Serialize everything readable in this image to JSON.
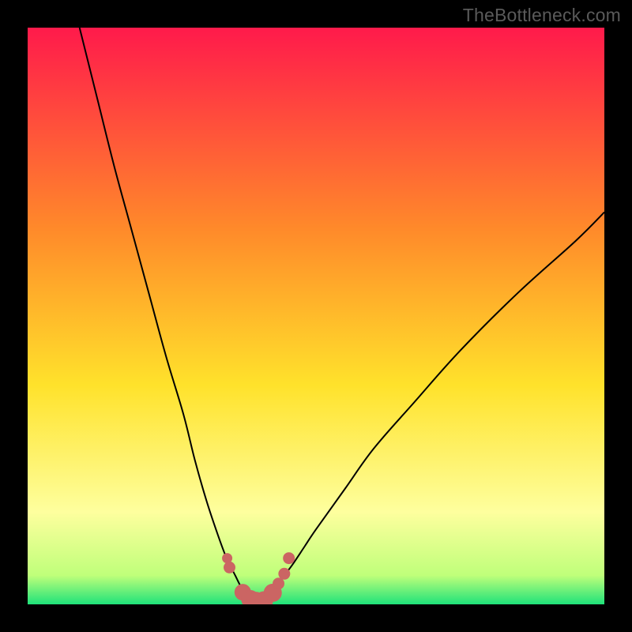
{
  "watermark": "TheBottleneck.com",
  "colors": {
    "frame": "#000000",
    "grad_top": "#ff1a4b",
    "grad_mid_orange": "#ff8a2a",
    "grad_yellow": "#ffe22b",
    "grad_pale_yellow": "#feff9e",
    "grad_near_bottom": "#bfff7a",
    "grad_bottom": "#1fe27a",
    "curve": "#000000",
    "marker_fill": "#cb6563",
    "marker_stroke": "#cb6563"
  },
  "chart_data": {
    "type": "line",
    "title": "",
    "xlabel": "",
    "ylabel": "",
    "xlim": [
      0,
      100
    ],
    "ylim": [
      0,
      100
    ],
    "series": [
      {
        "name": "left-branch",
        "x": [
          9,
          12,
          15,
          18,
          21,
          24,
          27,
          29,
          31,
          33,
          34.5,
          36,
          37,
          38,
          38.8
        ],
        "y": [
          100,
          88,
          76,
          65,
          54,
          43,
          33,
          25,
          18,
          12,
          8,
          5,
          3,
          1.5,
          0.5
        ]
      },
      {
        "name": "right-branch",
        "x": [
          41.2,
          42,
          43,
          44.5,
          46,
          48,
          50,
          55,
          60,
          67,
          75,
          85,
          95,
          100
        ],
        "y": [
          0.5,
          1.5,
          3,
          5,
          7,
          10,
          13,
          20,
          27,
          35,
          44,
          54,
          63,
          68
        ]
      },
      {
        "name": "valley-floor",
        "x": [
          38.8,
          39.5,
          40.2,
          41.2
        ],
        "y": [
          0.5,
          0.3,
          0.3,
          0.5
        ]
      }
    ],
    "markers": {
      "name": "highlight-points",
      "x": [
        34.6,
        35.0,
        37.3,
        38.6,
        39.6,
        41.0,
        42.5,
        43.5,
        44.5,
        45.3
      ],
      "y": [
        8.0,
        6.4,
        2.1,
        0.9,
        0.6,
        0.7,
        2.0,
        3.6,
        5.3,
        8.0
      ],
      "size": [
        6,
        7,
        10,
        11,
        11,
        11,
        11,
        7,
        7,
        7
      ]
    }
  }
}
